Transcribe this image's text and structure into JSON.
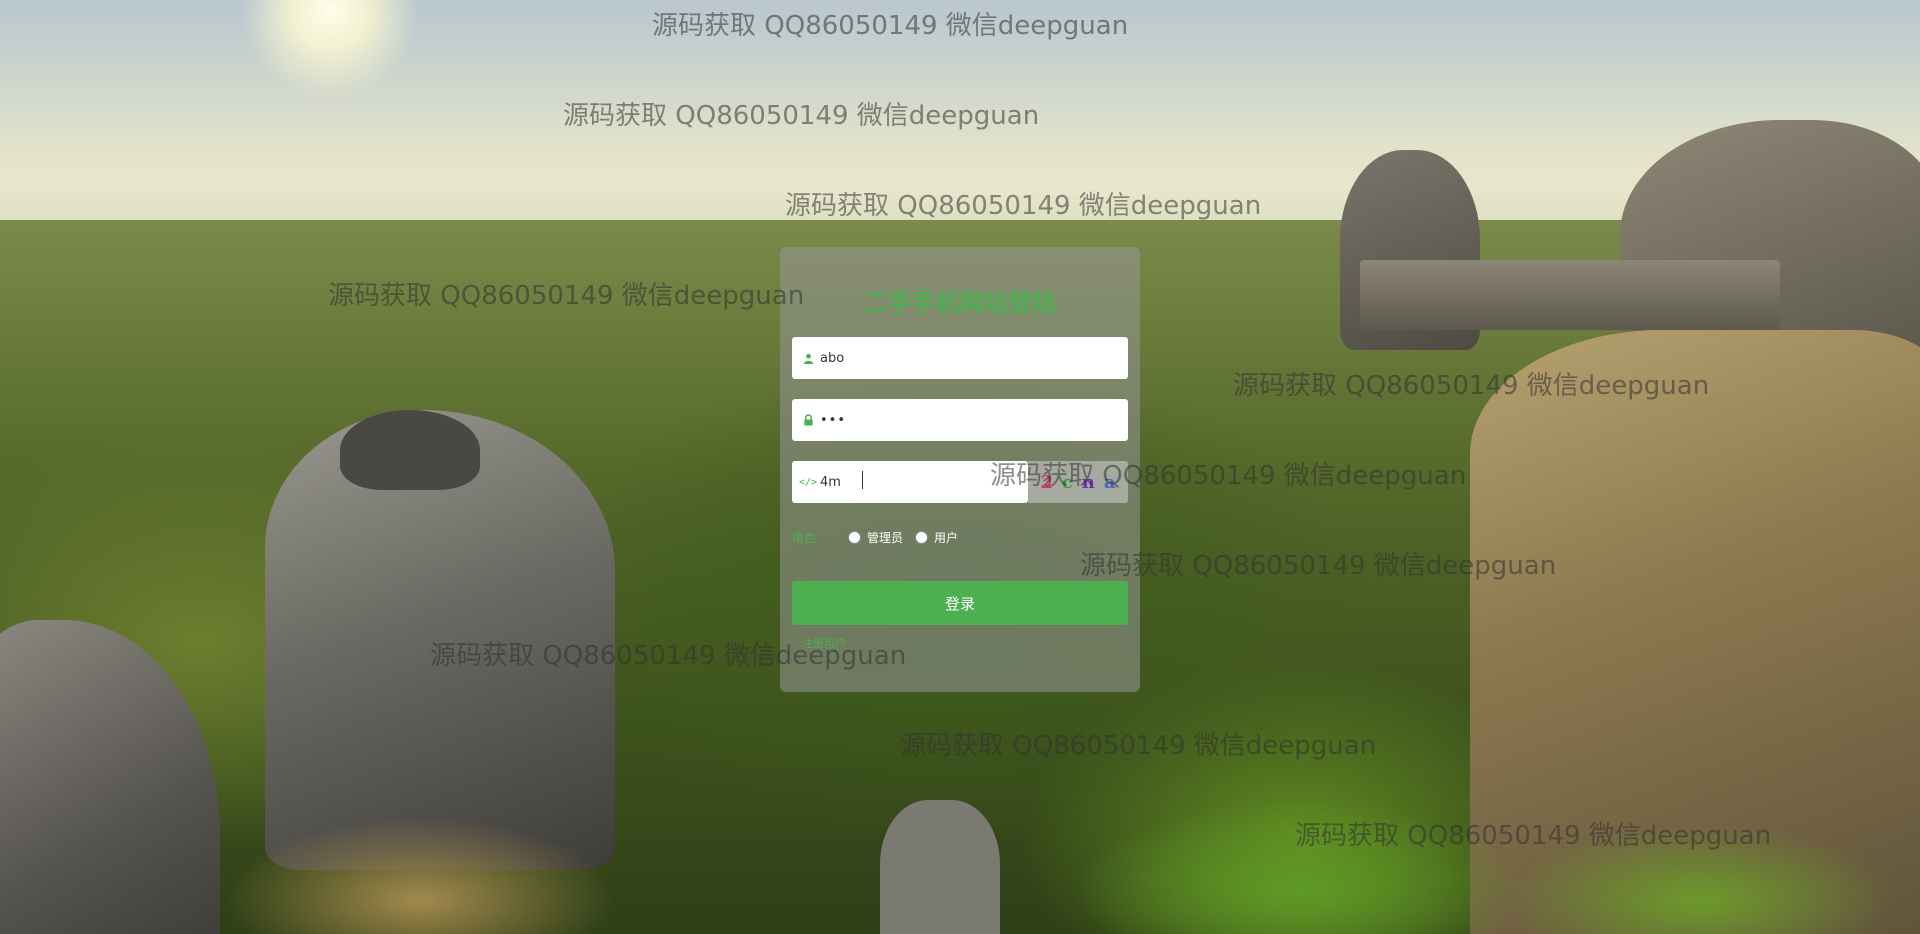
{
  "page": {
    "title": "二手手机网站登陆"
  },
  "login": {
    "title": "二手手机网站登陆",
    "username": {
      "value": "abo",
      "icon": "user-icon"
    },
    "password": {
      "value": "•••",
      "icon": "lock-icon"
    },
    "captcha": {
      "value": "4m",
      "icon": "code-icon",
      "image_chars": [
        "2",
        "c",
        "n",
        "a"
      ],
      "image_colors": [
        "#d6336c",
        "#2e9e3a",
        "#6b2fbf",
        "#4a63c9"
      ]
    },
    "role": {
      "label": "角色",
      "options": [
        "管理员",
        "用户"
      ]
    },
    "submit_label": "登录",
    "register_label": "注册用户"
  },
  "watermark": {
    "text": "源码获取 QQ86050149 微信deepguan"
  },
  "colors": {
    "accent": "#4caf50",
    "panel_bg": "rgba(150,150,150,0.55)"
  }
}
